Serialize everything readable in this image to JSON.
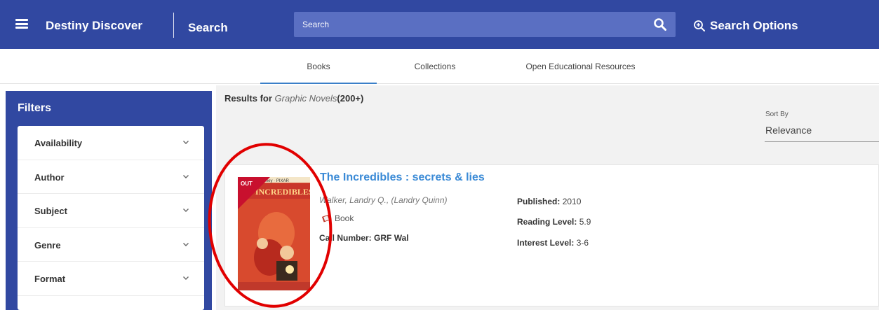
{
  "header": {
    "app_title": "Destiny Discover",
    "page_title": "Search",
    "search_placeholder": "Search",
    "search_options_label": "Search Options"
  },
  "tabs": [
    {
      "label": "Books",
      "active": true
    },
    {
      "label": "Collections",
      "active": false
    },
    {
      "label": "Open Educational Resources",
      "active": false
    }
  ],
  "filters": {
    "title": "Filters",
    "items": [
      "Availability",
      "Author",
      "Subject",
      "Genre",
      "Format"
    ]
  },
  "results": {
    "label": "Results for",
    "query": "Graphic Novels",
    "count": "(200+)",
    "sort_label": "Sort By",
    "sort_value": "Relevance"
  },
  "result_item": {
    "status_flag": "OUT",
    "title": "The Incredibles : secrets & lies",
    "author": "Walker, Landry Q., (Landry Quinn)",
    "format": "Book",
    "call_number_label": "Call Number:",
    "call_number_value": "GRF Wal",
    "published_label": "Published:",
    "published_value": "2010",
    "reading_level_label": "Reading Level:",
    "reading_level_value": "5.9",
    "interest_level_label": "Interest Level:",
    "interest_level_value": "3-6",
    "cover_brand": "Disney · PIXAR",
    "cover_title": "THE INCREDIBLES"
  },
  "colors": {
    "header_bg": "#3148a1",
    "search_bg": "#5a6fc2",
    "link_blue": "#3a8ad6",
    "out_flag": "#c8102e",
    "annotation_circle": "#e10000"
  },
  "icons": {
    "menu": "menu-icon",
    "search": "search-icon",
    "search_options": "zoom-plus-icon",
    "chevron": "chevron-down-icon",
    "book": "book-icon"
  }
}
